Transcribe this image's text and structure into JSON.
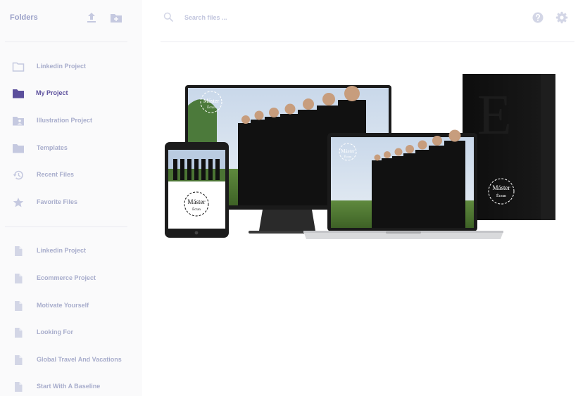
{
  "sidebar": {
    "title": "Folders",
    "header_icons": [
      "upload-icon",
      "new-folder-icon"
    ],
    "folders": [
      {
        "label": "Linkedin Project",
        "icon": "folder-outline-icon",
        "active": false
      },
      {
        "label": "My Project",
        "icon": "folder-icon",
        "active": true
      },
      {
        "label": "Illustration Project",
        "icon": "folder-shared-icon",
        "active": false
      },
      {
        "label": "Templates",
        "icon": "folder-icon",
        "active": false
      },
      {
        "label": "Recent Files",
        "icon": "history-icon",
        "active": false
      },
      {
        "label": "Favorite Files",
        "icon": "star-icon",
        "active": false
      }
    ],
    "files": [
      {
        "label": "Linkedin Project",
        "icon": "file-icon"
      },
      {
        "label": "Ecommerce Project",
        "icon": "file-icon"
      },
      {
        "label": "Motivate Yourself",
        "icon": "file-icon"
      },
      {
        "label": "Looking For",
        "icon": "file-icon"
      },
      {
        "label": "Global Travel And Vacations",
        "icon": "file-icon"
      },
      {
        "label": "Start With A Baseline",
        "icon": "file-icon"
      }
    ]
  },
  "topbar": {
    "search_placeholder": "Search files ...",
    "search_value": "",
    "icons": [
      "search-icon",
      "help-icon",
      "gear-icon"
    ]
  },
  "preview": {
    "badge_line1": "Máster",
    "badge_line2": "Écran",
    "box_letter": "E",
    "colors": {
      "accent": "#5b4f9c",
      "muted": "#a8adcc",
      "sidebar_bg": "#fafafb"
    }
  }
}
